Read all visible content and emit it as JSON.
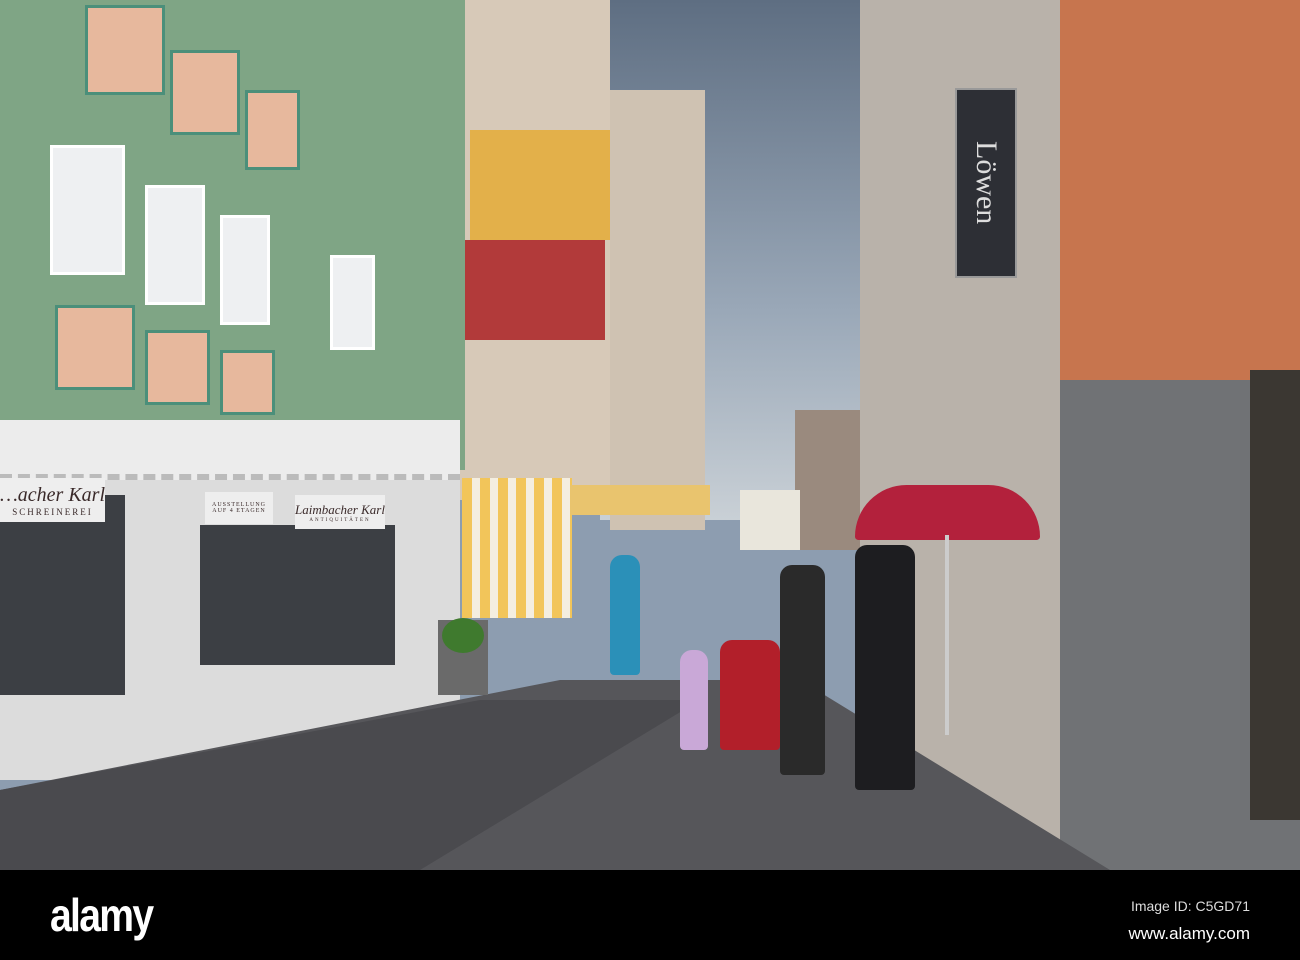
{
  "photo": {
    "signs": {
      "hanging_sign": "Löwen",
      "shop_left": "…acher Karl",
      "shop_left_sub": "SCHREINEREI",
      "exhibition_line1": "AUSSTELLUNG",
      "exhibition_line2": "AUF 4 ETAGEN",
      "shop_right": "Laimbacher Karl",
      "shop_right_sub": "ANTIQUITÄTEN"
    }
  },
  "watermark": {
    "logo": "alamy",
    "image_id": "Image ID: C5GD71",
    "url": "www.alamy.com"
  }
}
